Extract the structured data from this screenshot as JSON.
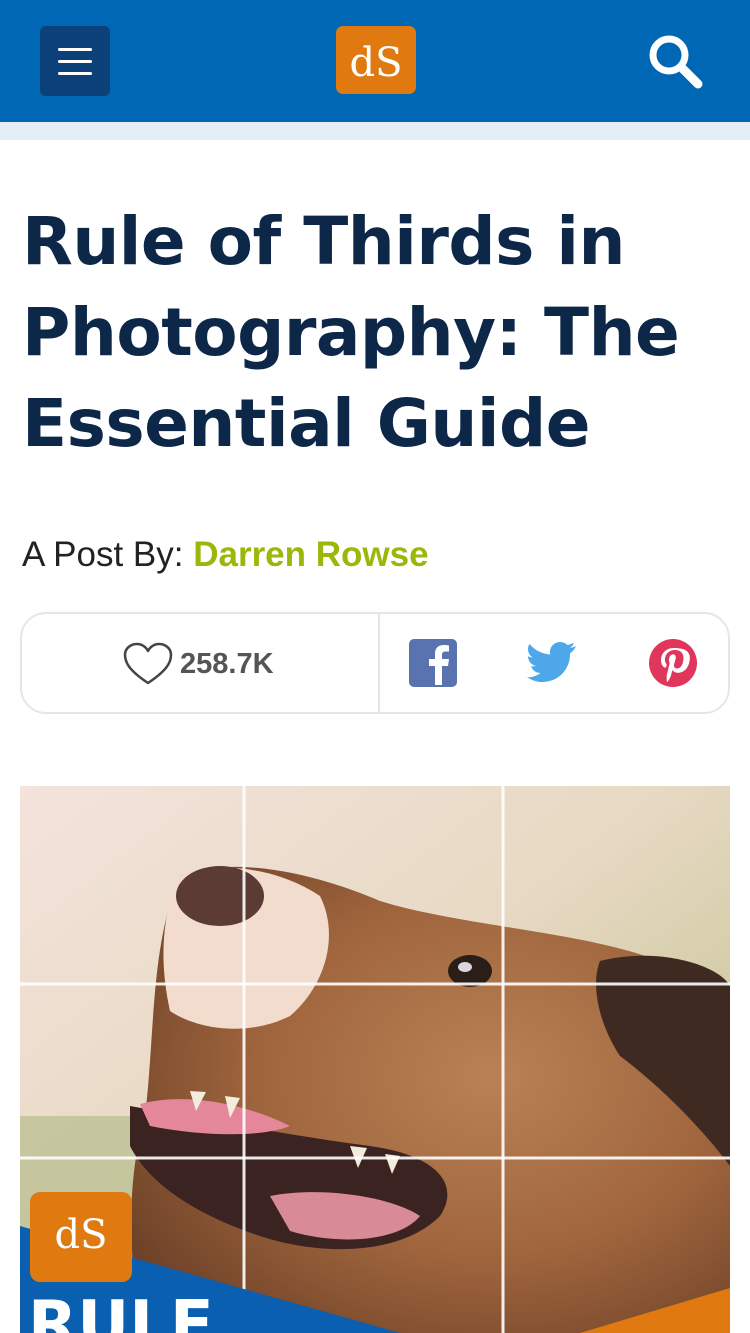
{
  "header": {
    "menu_icon": "hamburger-menu-icon",
    "logo_text": "dS",
    "search_icon": "search-icon",
    "brand_color": "#0067b4",
    "logo_color": "#e07a10"
  },
  "article": {
    "title": "Rule of Thirds in Photography: The Essential Guide",
    "byline_prefix": "A Post By:",
    "author": "Darren Rowse",
    "author_color": "#9cb70a"
  },
  "share": {
    "like_icon": "heart-icon",
    "like_count": "258.7K",
    "networks": [
      "facebook-icon",
      "twitter-icon",
      "pinterest-icon"
    ]
  },
  "hero": {
    "subject": "dog-photo-with-rule-of-thirds-grid",
    "badge_text": "dS",
    "banner_text": "RULE"
  }
}
